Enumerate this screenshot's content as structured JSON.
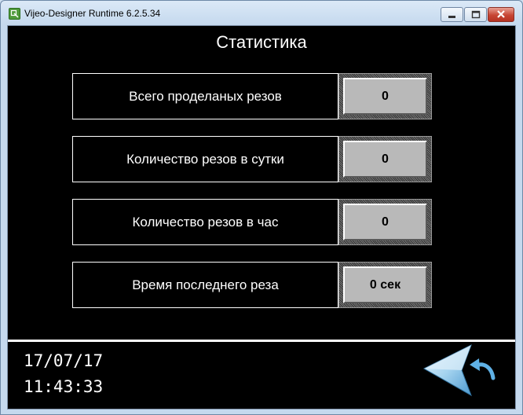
{
  "window": {
    "title": "Vijeo-Designer Runtime 6.2.5.34"
  },
  "screen": {
    "title": "Статистика",
    "stats": [
      {
        "label": "Всего проделаных резов",
        "value": "0"
      },
      {
        "label": "Количество резов в сутки",
        "value": "0"
      },
      {
        "label": "Количество резов в час",
        "value": "0"
      },
      {
        "label": "Время последнего реза",
        "value": "0 сек"
      }
    ]
  },
  "footer": {
    "date": "17/07/17",
    "time": "11:43:33"
  },
  "colors": {
    "background": "#000000",
    "text": "#ffffff",
    "value_field": "#b9b9b9",
    "back_arrow": "#7ec0ea"
  },
  "icons": {
    "back": "back-arrow-icon",
    "return": "return-arrow-icon"
  }
}
